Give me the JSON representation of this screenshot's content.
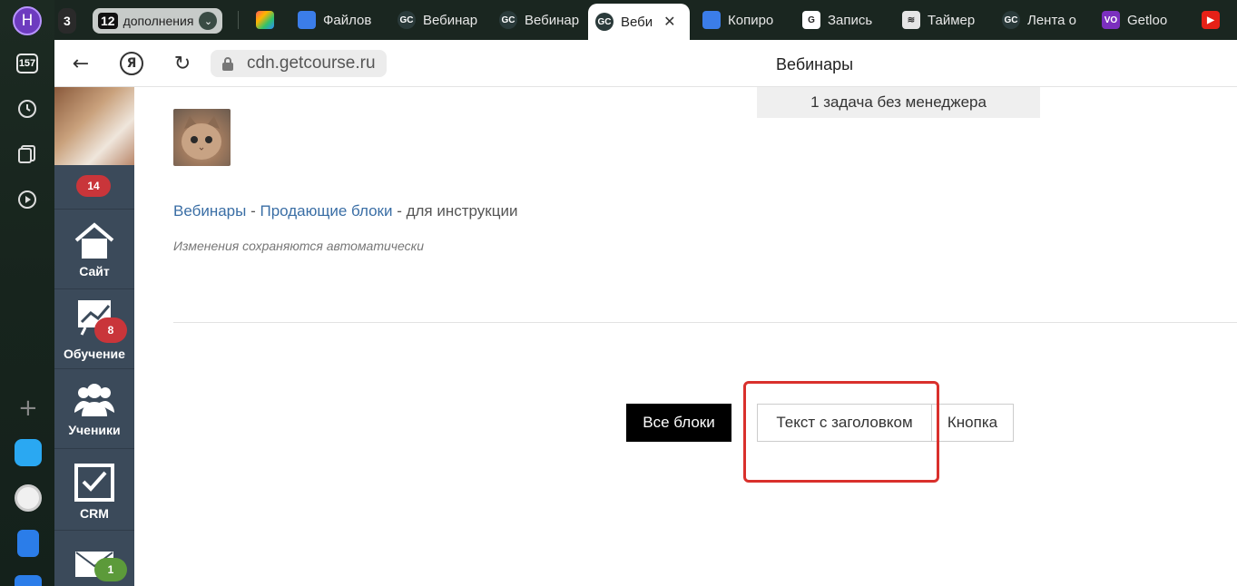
{
  "rail": {
    "profile_letter": "Н",
    "counter": "157",
    "colors": {
      "profile": "#6d3bbf"
    }
  },
  "tabs": {
    "group_count_a": "3",
    "group_count_b": "12",
    "group_label": "дополнения",
    "items": [
      {
        "label": "Файлов",
        "icon": "docs-icon"
      },
      {
        "label": "Вебинар",
        "icon": "gc-icon"
      },
      {
        "label": "Вебинар",
        "icon": "gc-icon"
      },
      {
        "label": "Веби",
        "icon": "gc-icon",
        "active": true
      },
      {
        "label": "Копиро",
        "icon": "docs-icon"
      },
      {
        "label": "Запись",
        "icon": "g-icon"
      },
      {
        "label": "Таймер",
        "icon": "layers-icon"
      },
      {
        "label": "Лента о",
        "icon": "gc-icon"
      },
      {
        "label": "Getloo",
        "icon": "vo-icon"
      },
      {
        "label": "",
        "icon": "youtube-icon"
      }
    ]
  },
  "toolbar": {
    "url": "cdn.getcourse.ru",
    "page_title": "Вебинары",
    "yandex_glyph": "Я"
  },
  "sidebar": {
    "top_badge": "14",
    "items": [
      {
        "label": "Сайт",
        "icon": "home-icon"
      },
      {
        "label": "Обучение",
        "icon": "chart-icon",
        "badge": "8"
      },
      {
        "label": "Ученики",
        "icon": "users-icon"
      },
      {
        "label": "CRM",
        "icon": "checkbox-icon"
      },
      {
        "label": "",
        "icon": "mail-icon",
        "badge": "1"
      }
    ]
  },
  "main": {
    "task_box": "1 задача без менеджера",
    "breadcrumb": {
      "link1": "Вебинары",
      "sep1": " - ",
      "link2": "Продающие блоки",
      "sep2": " - ",
      "current": "для инструкции"
    },
    "autosave_note": "Изменения сохраняются автоматически",
    "buttons": {
      "all_blocks": "Все блоки",
      "text_with_heading": "Текст с заголовком",
      "button": "Кнопка"
    },
    "colors": {
      "link": "#3a6ea5",
      "highlight": "#d9302c",
      "badge_red": "#c9353a",
      "badge_green": "#5c9a3a"
    }
  }
}
